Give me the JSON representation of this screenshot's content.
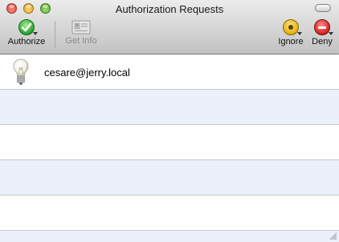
{
  "window": {
    "title": "Authorization Requests"
  },
  "toolbar": {
    "authorize_label": "Authorize",
    "get_info_label": "Get Info",
    "ignore_label": "Ignore",
    "deny_label": "Deny"
  },
  "requests": [
    {
      "user": "cesare@jerry.local",
      "icon": "lightbulb-icon"
    }
  ],
  "colors": {
    "row_alternate": "#ebf0fb",
    "authorize_green": "#27a227",
    "ignore_yellow": "#e2b011",
    "deny_red": "#d42323"
  }
}
